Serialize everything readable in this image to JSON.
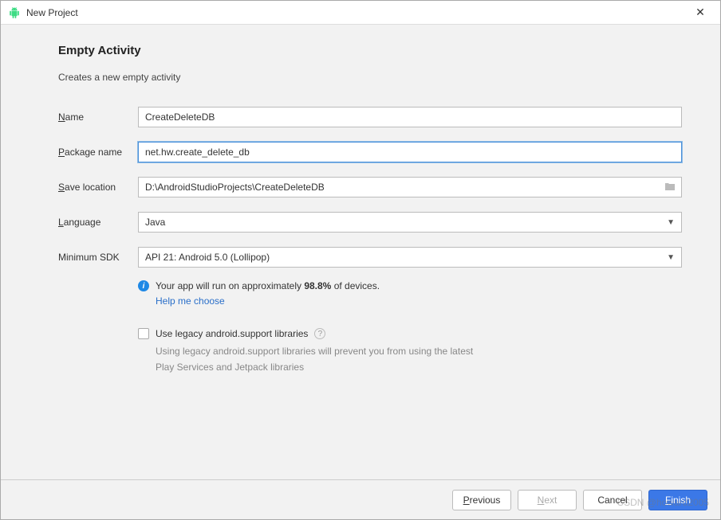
{
  "window": {
    "title": "New Project"
  },
  "page": {
    "heading": "Empty Activity",
    "subheading": "Creates a new empty activity"
  },
  "labels": {
    "name_prefix_u": "N",
    "name_rest": "ame",
    "package_prefix_u": "P",
    "package_rest": "ackage name",
    "save_prefix_u": "S",
    "save_rest": "ave location",
    "language_prefix_u": "L",
    "language_rest": "anguage",
    "minsdk": "Minimum SDK"
  },
  "fields": {
    "name": "CreateDeleteDB",
    "package": "net.hw.create_delete_db",
    "save_location": "D:\\AndroidStudioProjects\\CreateDeleteDB",
    "language": "Java",
    "min_sdk": "API 21: Android 5.0 (Lollipop)"
  },
  "info": {
    "text_pre": "Your app will run on approximately ",
    "percent": "98.8%",
    "text_post": " of devices.",
    "link": "Help me choose"
  },
  "legacy": {
    "checkbox_label": "Use legacy android.support libraries",
    "description": "Using legacy android.support libraries will prevent you from using the latest Play Services and Jetpack libraries"
  },
  "buttons": {
    "previous_u": "P",
    "previous_rest": "revious",
    "next_u": "N",
    "next_rest": "ext",
    "cancel": "Cancel",
    "finish_u": "F",
    "finish_rest": "inish"
  },
  "watermark": "CSDN @howard2005"
}
